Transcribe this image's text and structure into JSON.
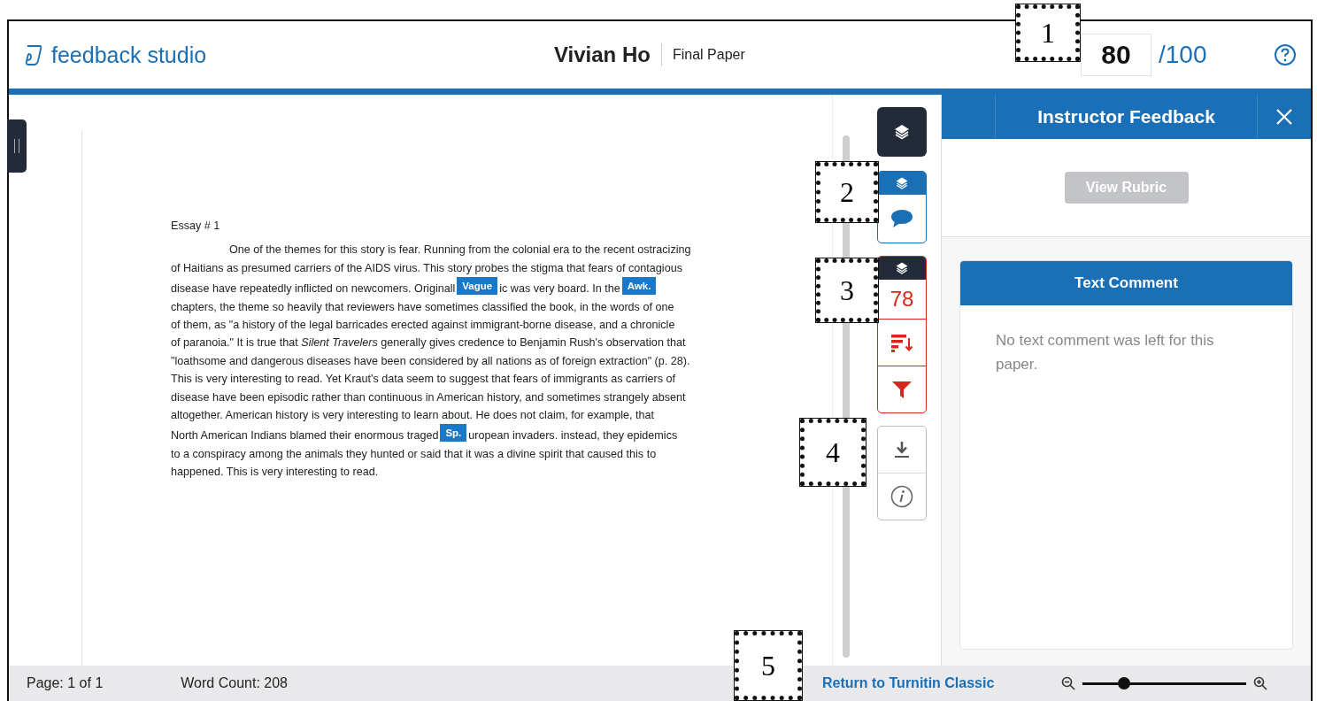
{
  "header": {
    "logo": "feedback studio",
    "student": "Vivian Ho",
    "assignment": "Final Paper",
    "score": "80",
    "score_total": "/100"
  },
  "document": {
    "title": "Essay # 1",
    "lines": [
      [
        {
          "kind": "text",
          "text": "One of the themes for this story is fear. Running from the colonial era to the recent ostracizing"
        }
      ],
      [
        {
          "kind": "text",
          "text": "of Haitians as presumed carriers of the AIDS virus. This story probes the stigma that fears of contagious"
        }
      ],
      [
        {
          "kind": "text",
          "text": "disease have repeatedly inflicted on newcomers. Originall"
        },
        {
          "kind": "mark",
          "text": "Vague"
        },
        {
          "kind": "text",
          "text": "ic was very board. In the"
        },
        {
          "kind": "mark",
          "text": "Awk."
        }
      ],
      [
        {
          "kind": "text",
          "text": "chapters, the theme so heavily that reviewers have sometimes classified the book, in the words of one"
        }
      ],
      [
        {
          "kind": "text",
          "text": "of them, as \"a history of the legal barricades erected against immigrant-borne disease, and a chronicle"
        }
      ],
      [
        {
          "kind": "text",
          "text": "of paranoia.\" It is true that *Silent Travelers* generally gives credence to Benjamin Rush's observation that"
        }
      ],
      [
        {
          "kind": "text",
          "text": "\"loathsome and dangerous diseases have been considered by all nations as of foreign extraction\" (p. 28)."
        }
      ],
      [
        {
          "kind": "text",
          "text": "This is very interesting to read. Yet Kraut's data seem to suggest that fears of immigrants as carriers of"
        }
      ],
      [
        {
          "kind": "text",
          "text": "disease have been episodic rather than continuous in American history, and sometimes strangely absent"
        }
      ],
      [
        {
          "kind": "text",
          "text": "altogether. American history is very interesting to learn about.  He does not claim, for example, that"
        }
      ],
      [
        {
          "kind": "text",
          "text": "North American Indians blamed their enormous traged"
        },
        {
          "kind": "mark",
          "text": "Sp."
        },
        {
          "kind": "text",
          "text": "uropean invaders. instead, they epidemics"
        }
      ],
      [
        {
          "kind": "text",
          "text": "to a conspiracy among the animals they hunted or said that it was a divine spirit that caused this to"
        }
      ],
      [
        {
          "kind": "text",
          "text": "happened. This is very interesting to read."
        }
      ]
    ]
  },
  "tool_groups": [
    {
      "kind": "layers-button"
    },
    {
      "kind": "layer",
      "selected": true,
      "items": [
        {
          "kind": "comment"
        }
      ]
    },
    {
      "kind": "layer",
      "selected": false,
      "items": [
        {
          "kind": "score",
          "text": "78"
        },
        {
          "kind": "sort"
        },
        {
          "kind": "filter"
        }
      ]
    },
    {
      "kind": "plain",
      "items": [
        {
          "kind": "download"
        },
        {
          "kind": "info"
        }
      ]
    }
  ],
  "panel": {
    "title": "Instructor Feedback",
    "rubric_button": {
      "label": "View Rubric",
      "disabled": true
    },
    "card_title": "Text Comment",
    "card_text": "No text comment was left for this paper."
  },
  "status_bar": {
    "page": "Page: 1 of 1",
    "word_count": "Word Count: 208",
    "link": "Return to Turnitin Classic",
    "zoom": {
      "level": 0.25
    }
  },
  "callouts": [
    {
      "label": "1"
    },
    {
      "label": "2"
    },
    {
      "label": "3"
    },
    {
      "label": "4"
    },
    {
      "label": "5"
    }
  ]
}
